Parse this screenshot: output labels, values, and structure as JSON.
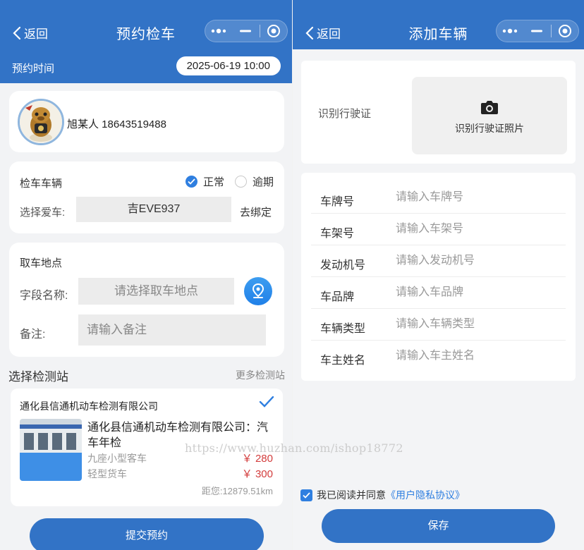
{
  "left": {
    "nav": {
      "back_label": "返回",
      "title": "预约检车"
    },
    "time": {
      "label": "预约时间",
      "value": "2025-06-19 10:00"
    },
    "user": {
      "name_phone": "旭某人 18643519488"
    },
    "vehicle": {
      "title": "检车车辆",
      "status_normal": "正常",
      "status_overdue": "逾期",
      "choose_label": "选择爱车:",
      "plate": "吉EVE937",
      "unbind": "去绑定"
    },
    "pickup": {
      "title": "取车地点",
      "field_label": "字段名称:",
      "field_placeholder": "请选择取车地点",
      "note_label": "备注:",
      "note_placeholder": "请输入备注"
    },
    "stations": {
      "title": "选择检测站",
      "more": "更多检测站",
      "station_name": "通化县信通机动车检测有限公司",
      "service_title": "通化县信通机动车检测有限公司：汽车年检",
      "items": [
        {
          "name": "九座小型客车",
          "price": "￥ 280"
        },
        {
          "name": "轻型货车",
          "price": "￥ 300"
        }
      ],
      "distance": "距您:12879.51km"
    },
    "submit": "提交预约"
  },
  "right": {
    "nav": {
      "back_label": "返回",
      "title": "添加车辆"
    },
    "scan": {
      "label": "识别行驶证",
      "button": "识别行驶证照片"
    },
    "fields": [
      {
        "label": "车牌号",
        "placeholder": "请输入车牌号"
      },
      {
        "label": "车架号",
        "placeholder": "请输入车架号"
      },
      {
        "label": "发动机号",
        "placeholder": "请输入发动机号"
      },
      {
        "label": "车品牌",
        "placeholder": "请输入车品牌"
      },
      {
        "label": "车辆类型",
        "placeholder": "请输入车辆类型"
      },
      {
        "label": "车主姓名",
        "placeholder": "请输入车主姓名"
      }
    ],
    "agree_text": "我已阅读并同意",
    "agree_link": "《用户隐私协议》",
    "save": "保存"
  },
  "watermark": "https://www.huzhan.com/ishop18772",
  "colors": {
    "primary": "#3273c6",
    "accent": "#2f7fe0",
    "price": "#d33d3d"
  }
}
